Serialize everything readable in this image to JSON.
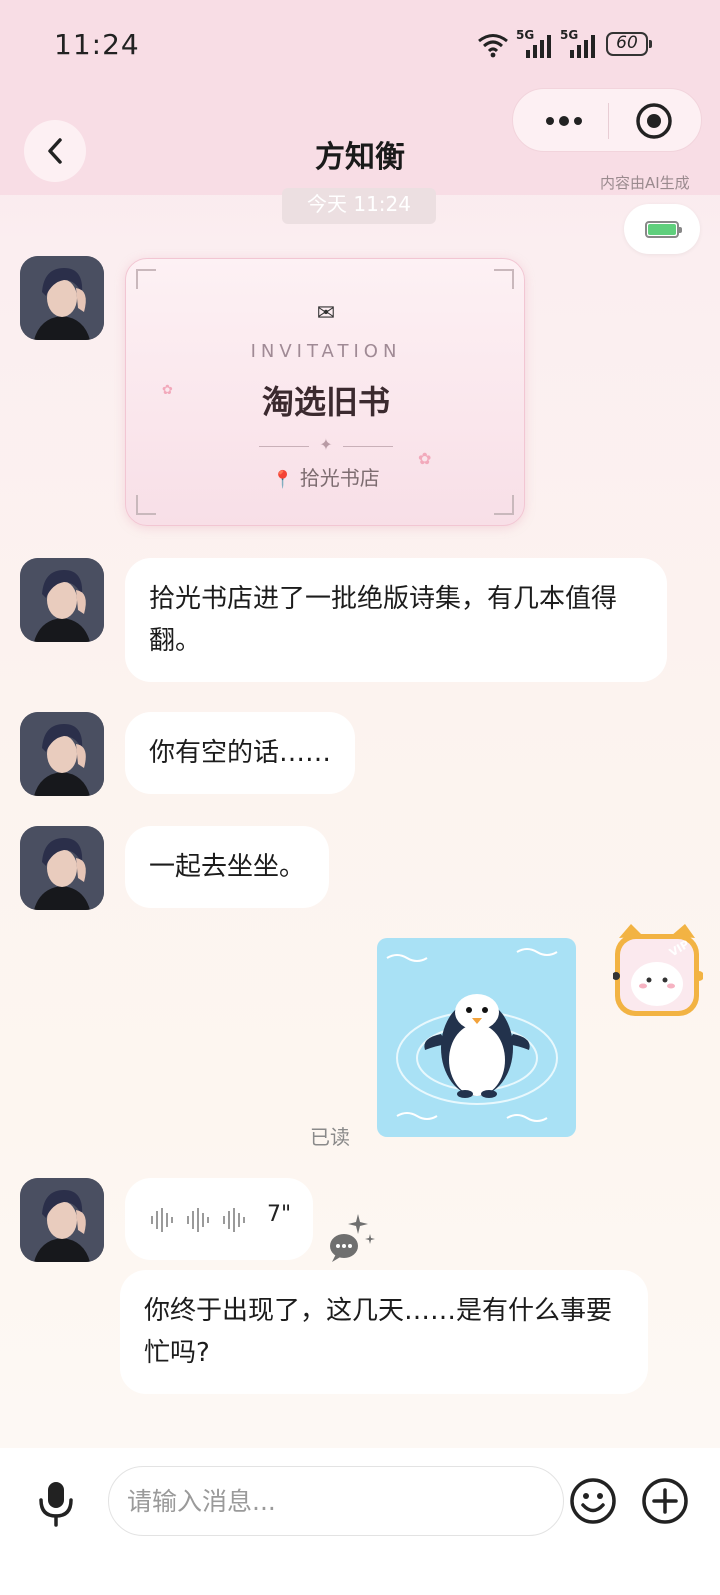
{
  "status_bar": {
    "time": "11:24",
    "signal_1_label": "5G",
    "signal_2_label": "5G",
    "battery_level": "60"
  },
  "header": {
    "title": "方知衡",
    "ai_note": "内容由AI生成",
    "menu_icon": "more-dots-icon",
    "capsule_icon": "target-close-icon"
  },
  "chat": {
    "time_chip": "今天 11:24",
    "invitation": {
      "icon": "✉",
      "label": "INVITATION",
      "title": "淘选旧书",
      "divider_glyph": "✦",
      "pin_icon": "📍",
      "place": "拾光书店"
    },
    "messages": [
      {
        "from": "contact",
        "text": "拾光书店进了一批绝版诗集，有几本值得翻。"
      },
      {
        "from": "contact",
        "text": "你有空的话……"
      },
      {
        "from": "contact",
        "text": "一起去坐坐。"
      }
    ],
    "user_sticker": {
      "content": "penguin-floating-sticker",
      "vip_badge": "VIP"
    },
    "read_status": "已读",
    "voice_message": {
      "duration": "7\""
    },
    "last_message": "你终于出现了，这几天……是有什么事要忙吗?"
  },
  "input_bar": {
    "placeholder": "请输入消息...",
    "mic_icon": "microphone-icon",
    "emoji_icon": "emoji-icon",
    "add_icon": "plus-circle-icon"
  },
  "colors": {
    "header_bg": "#f8dde5",
    "bubble_bg": "#ffffff",
    "invite_bg": "#f8dfe7",
    "sticker_bg": "#a9e1f5"
  }
}
